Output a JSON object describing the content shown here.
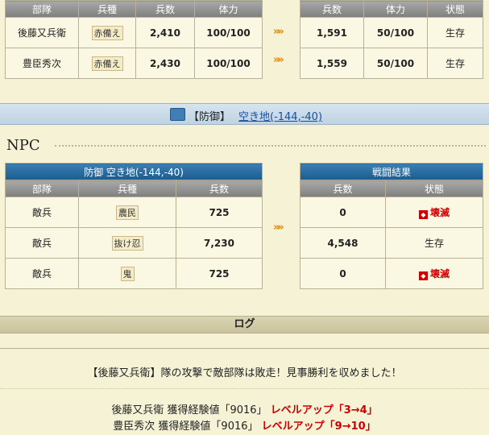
{
  "top_left": {
    "headers": [
      "部隊",
      "兵種",
      "兵数",
      "体力"
    ],
    "rows": [
      {
        "unit": "後藤又兵衛",
        "type": "赤備え",
        "count": "2,410",
        "hp": "100/100"
      },
      {
        "unit": "豊臣秀次",
        "type": "赤備え",
        "count": "2,430",
        "hp": "100/100"
      }
    ]
  },
  "top_right": {
    "headers": [
      "兵数",
      "体力",
      "状態"
    ],
    "rows": [
      {
        "count": "1,591",
        "hp": "50/100",
        "status": "生存"
      },
      {
        "count": "1,559",
        "hp": "50/100",
        "status": "生存"
      }
    ]
  },
  "arrow": "»»",
  "defense": {
    "prefix": "【防御】",
    "link": "空き地(-144,-40)"
  },
  "npc_label": "NPC",
  "npc_left": {
    "title": "防御 空き地(-144,-40)",
    "headers": [
      "部隊",
      "兵種",
      "兵数"
    ],
    "rows": [
      {
        "unit": "敵兵",
        "type": "農民",
        "count": "725"
      },
      {
        "unit": "敵兵",
        "type": "抜け忍",
        "count": "7,230"
      },
      {
        "unit": "敵兵",
        "type": "鬼",
        "count": "725"
      }
    ]
  },
  "npc_right": {
    "title": "戦闘結果",
    "headers": [
      "兵数",
      "状態"
    ],
    "rows": [
      {
        "count": "0",
        "status": "壊滅",
        "destroyed": true
      },
      {
        "count": "4,548",
        "status": "生存",
        "destroyed": false
      },
      {
        "count": "0",
        "status": "壊滅",
        "destroyed": true
      }
    ]
  },
  "log": {
    "title": "ログ",
    "message": "【後藤又兵衛】隊の攻撃で敵部隊は敗走！見事勝利を収めました！",
    "exp1": {
      "text": "後藤又兵衛 獲得経験値「9016」",
      "levelup": "レベルアップ「3→4」"
    },
    "exp2": {
      "text": "豊臣秀次 獲得経験値「9016」",
      "levelup": "レベルアップ「9→10」"
    }
  },
  "colors": {
    "header_gray": "#8c8c8c",
    "header_blue": "#2a6ea3",
    "destroyed": "#cc0000",
    "arrow": "#e08a10"
  }
}
